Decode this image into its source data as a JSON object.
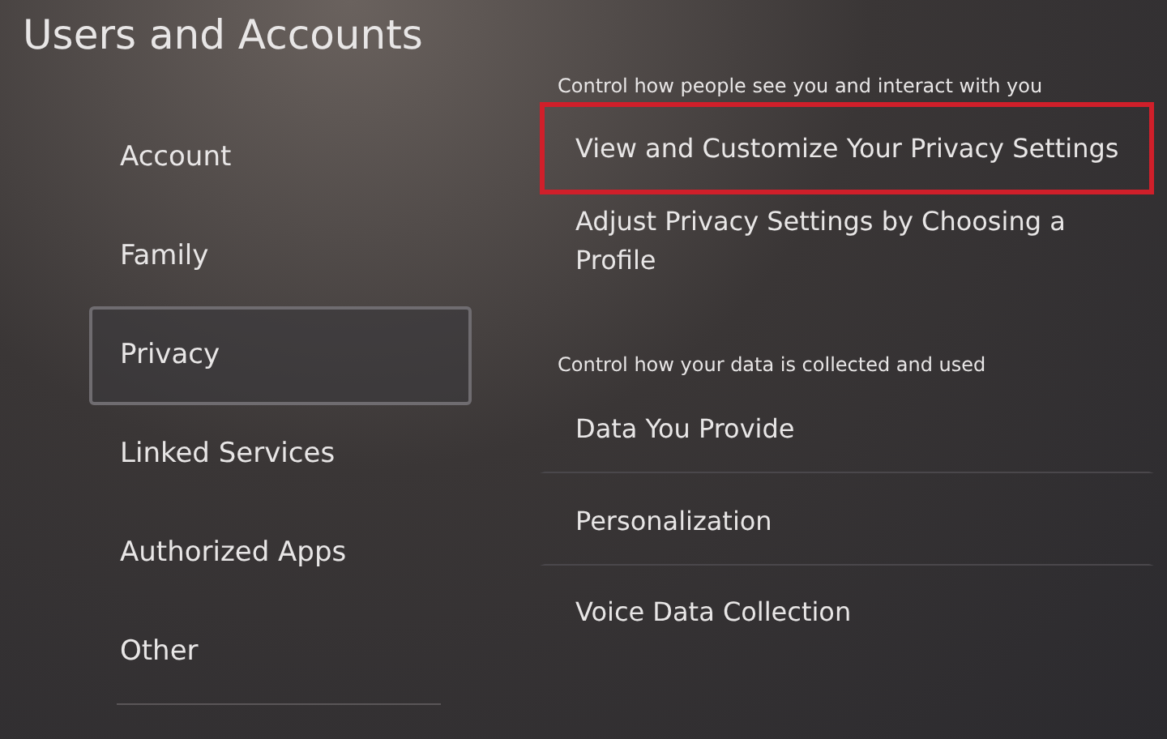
{
  "title": "Users and Accounts",
  "sidebar": {
    "items": [
      {
        "label": "Account",
        "selected": false
      },
      {
        "label": "Family",
        "selected": false
      },
      {
        "label": "Privacy",
        "selected": true
      },
      {
        "label": "Linked Services",
        "selected": false
      },
      {
        "label": "Authorized Apps",
        "selected": false
      },
      {
        "label": "Other",
        "selected": false
      }
    ]
  },
  "sections": [
    {
      "heading": "Control how people see you and interact with you",
      "items": [
        {
          "label": "View and Customize Your Privacy Settings",
          "highlighted": true
        },
        {
          "label": "Adjust Privacy Settings by Choosing a Profile",
          "highlighted": false
        }
      ]
    },
    {
      "heading": "Control how your data is collected and used",
      "items": [
        {
          "label": "Data You Provide",
          "highlighted": false
        },
        {
          "label": "Personalization",
          "highlighted": false
        },
        {
          "label": "Voice Data Collection",
          "highlighted": false
        }
      ]
    }
  ]
}
